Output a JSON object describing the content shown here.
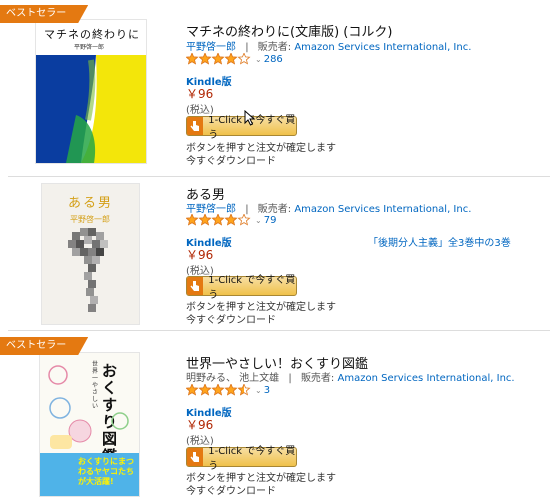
{
  "items": [
    {
      "badge": "ベストセラー",
      "cover_title": "マチネの終わりに",
      "cover_author": "平野啓一郎",
      "title": "マチネの終わりに(文庫版) (コルク)",
      "author": "平野啓一郎",
      "separator": "|",
      "seller_label": "販売者:",
      "seller": "Amazon Services International, Inc.",
      "rating_stars": 4,
      "rating_chevron": "⌄",
      "rating_count": "286",
      "format": "Kindle版",
      "price": "￥96",
      "tax": "(税込)",
      "buy_button": "1-Click で今すぐ買う",
      "note1": "ボタンを押すと注文が確定します",
      "note2": "今すぐダウンロード"
    },
    {
      "badge": "",
      "cover_title": "ある男",
      "cover_author": "平野啓一郎",
      "title": "ある男",
      "author": "平野啓一郎",
      "separator": "|",
      "seller_label": "販売者:",
      "seller": "Amazon Services International, Inc.",
      "rating_stars": 4,
      "rating_chevron": "⌄",
      "rating_count": "79",
      "format": "Kindle版",
      "series": "「後期分人主義」全3巻中の3巻",
      "price": "￥96",
      "tax": "(税込)",
      "buy_button": "1-Click で今すぐ買う",
      "note1": "ボタンを押すと注文が確定します",
      "note2": "今すぐダウンロード"
    },
    {
      "badge": "ベストセラー",
      "cover_title": "おくすり図鑑",
      "cover_subtitle": "世界一やさしい",
      "cover_banner": "おくすりにまつわるヤヤコたちが大活躍!",
      "title": "世界一やさしい！おくすり図鑑",
      "author": "明野みる、 池上文雄",
      "separator": "|",
      "seller_label": "販売者:",
      "seller": "Amazon Services International, Inc.",
      "rating_stars": 4.5,
      "rating_chevron": "⌄",
      "rating_count": "3",
      "format": "Kindle版",
      "price": "￥96",
      "tax": "(税込)",
      "buy_button": "1-Click で今すぐ買う",
      "note1": "ボタンを押すと注文が確定します",
      "note2": "今すぐダウンロード"
    }
  ],
  "colors": {
    "badge": "#e47911",
    "link": "#0066c0",
    "price": "#b12704",
    "star": "#ffa41c",
    "button": "#f0c14b"
  }
}
